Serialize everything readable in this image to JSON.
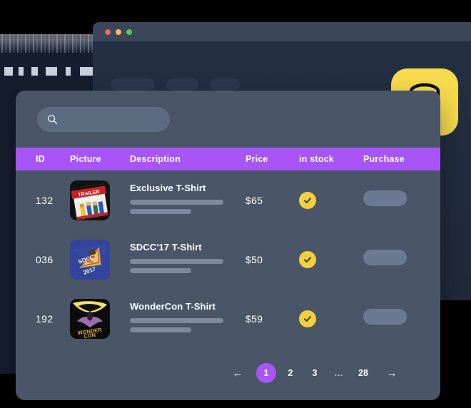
{
  "window_back": {
    "traffic_lights": [
      "close-red",
      "minimize-yellow",
      "maximize-green"
    ],
    "ghost_tabs": [
      "",
      "",
      ""
    ]
  },
  "badge": {
    "icon": "database-icon",
    "background_color": "#f7db4e",
    "icon_color": "#111111"
  },
  "search": {
    "icon": "search-icon",
    "value": "",
    "placeholder": ""
  },
  "table": {
    "header_color": "#a855f7",
    "columns": [
      {
        "key": "id",
        "label": "ID"
      },
      {
        "key": "picture",
        "label": "Picture"
      },
      {
        "key": "description",
        "label": "Description"
      },
      {
        "key": "price",
        "label": "Price"
      },
      {
        "key": "in_stock",
        "label": "in stock"
      },
      {
        "key": "purchase",
        "label": "Purchase"
      }
    ],
    "rows": [
      {
        "id": "132",
        "picture_alt": "Trailer Park Boys shirt thumbnail",
        "title": "Exclusive T-Shirt",
        "price": "$65",
        "in_stock": true,
        "stock_icon": "check-circle-icon",
        "purchase_label": ""
      },
      {
        "id": "036",
        "picture_alt": "SDCC 2017 pizza shirt thumbnail",
        "title": "SDCC'17 T-Shirt",
        "price": "$50",
        "in_stock": true,
        "stock_icon": "check-circle-icon",
        "purchase_label": ""
      },
      {
        "id": "192",
        "picture_alt": "WonderCon Batman shirt thumbnail",
        "title": "WonderCon T-Shirt",
        "price": "$59",
        "in_stock": true,
        "stock_icon": "check-circle-icon",
        "purchase_label": ""
      }
    ]
  },
  "pagination": {
    "prev_icon": "arrow-left-icon",
    "next_icon": "arrow-right-icon",
    "pages": [
      "1",
      "2",
      "3",
      "…",
      "28"
    ],
    "current": "1",
    "active_color": "#a855f7"
  }
}
